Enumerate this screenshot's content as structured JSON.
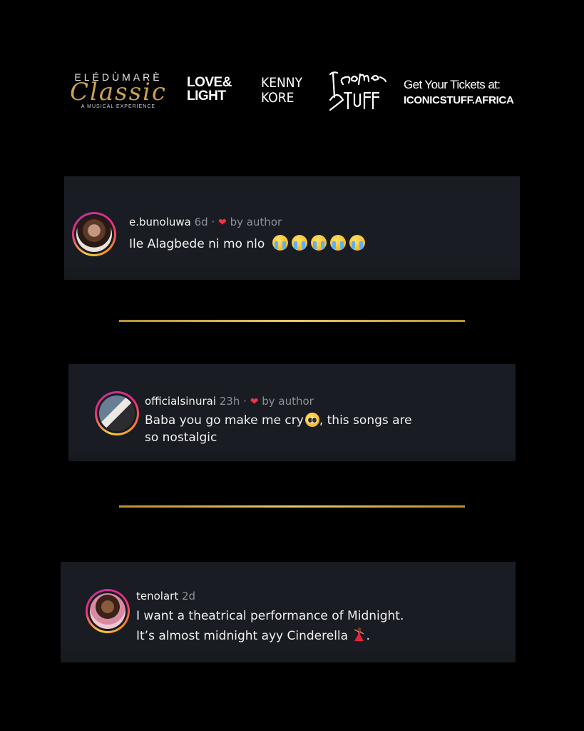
{
  "header": {
    "classic_top": "ELÉDÙMARÈ",
    "classic_script": "Classic",
    "classic_sub": "A MUSICAL EXPERIENCE",
    "lovelight_line1": "LOVE&",
    "lovelight_line2": "LIGHT",
    "kenny_line1": "KENNY",
    "kenny_line2": "KORE",
    "iconic_logo_icon": "iconic-stuff-script-logo",
    "tickets_line1": "Get Your Tickets at:",
    "tickets_line2": "ICONICSTUFF.AFRICA"
  },
  "comments": [
    {
      "username": "e.bunoluwa",
      "time": "6d",
      "separator": "·",
      "liked_by": "by author",
      "text": "Ile Alagbede ni mo nlo",
      "emoji_icon": "loudly-crying-face-emoji"
    },
    {
      "username": "officialsinurai",
      "time": "23h",
      "separator": "·",
      "liked_by": "by author",
      "text_part1": "Baba you go make me cry",
      "text_part2": ", this songs are",
      "text_line2": "so nostalgic",
      "emoji_icon": "pleading-face-emoji"
    },
    {
      "username": "tenolart",
      "time": "2d",
      "text_line1": "I want a theatrical performance of Midnight.",
      "text_line2": "It’s almost midnight ayy Cinderella",
      "text_line2_end": ".",
      "emoji_icon": "dancer-emoji"
    }
  ],
  "colors": {
    "background": "#000000",
    "card": "#191c22",
    "gold": "#d4b057",
    "heart": "#ff3040"
  }
}
